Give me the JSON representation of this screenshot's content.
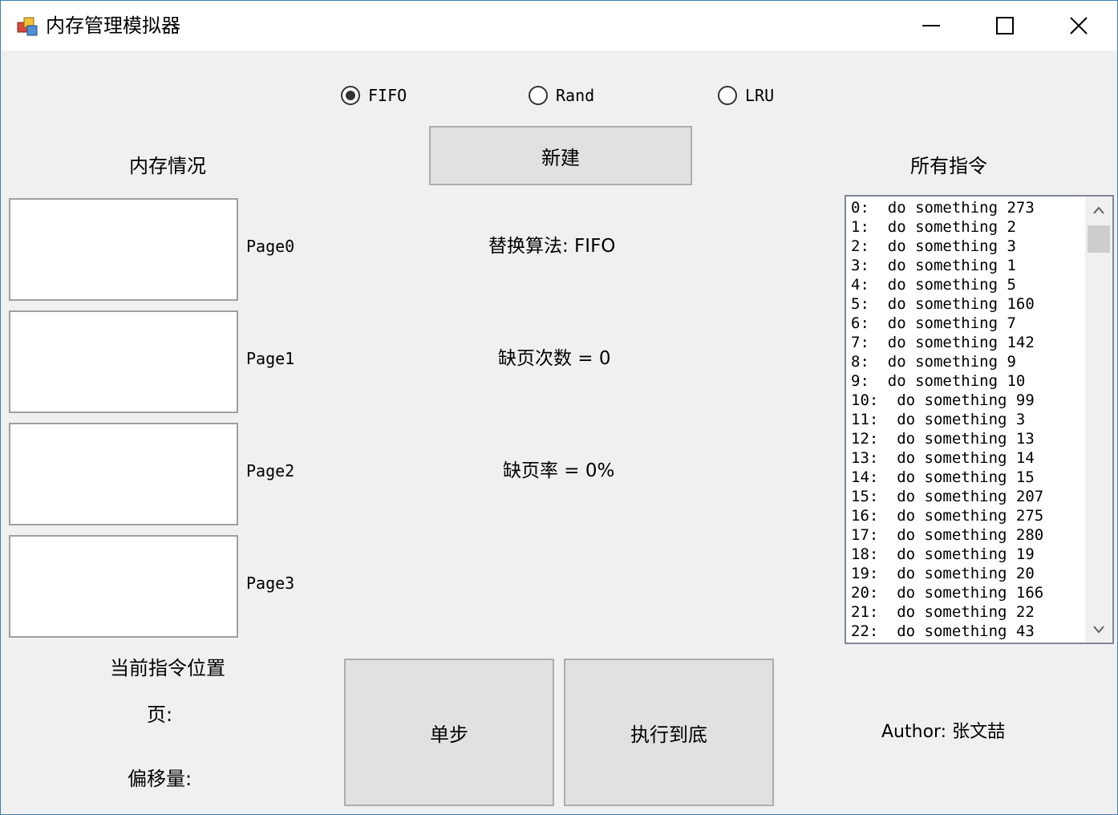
{
  "window": {
    "title": "内存管理模拟器"
  },
  "algorithms": [
    {
      "label": "FIFO",
      "checked": true
    },
    {
      "label": "Rand",
      "checked": false
    },
    {
      "label": "LRU",
      "checked": false
    }
  ],
  "new_button": "新建",
  "memory": {
    "heading": "内存情况",
    "pages": [
      "Page0",
      "Page1",
      "Page2",
      "Page3"
    ]
  },
  "stats": {
    "algorithm": "替换算法: FIFO",
    "faults": "缺页次数 = 0",
    "fault_rate": "缺页率 = 0%"
  },
  "instructions": {
    "heading": "所有指令",
    "items": [
      "0:  do something 273",
      "1:  do something 2",
      "2:  do something 3",
      "3:  do something 1",
      "4:  do something 5",
      "5:  do something 160",
      "6:  do something 7",
      "7:  do something 142",
      "8:  do something 9",
      "9:  do something 10",
      "10:  do something 99",
      "11:  do something 3",
      "12:  do something 13",
      "13:  do something 14",
      "14:  do something 15",
      "15:  do something 207",
      "16:  do something 275",
      "17:  do something 280",
      "18:  do something 19",
      "19:  do something 20",
      "20:  do something 166",
      "21:  do something 22",
      "22:  do something 43"
    ]
  },
  "current": {
    "heading": "当前指令位置",
    "page_label": "页:",
    "offset_label": "偏移量:"
  },
  "controls": {
    "step": "单步",
    "run_all": "执行到底"
  },
  "author": "Author: 张文喆",
  "icons": {
    "app": "app-icon",
    "minimize": "minimize-icon",
    "maximize": "maximize-icon",
    "close": "close-icon",
    "scroll_up": "chevron-up-icon",
    "scroll_down": "chevron-down-icon"
  }
}
